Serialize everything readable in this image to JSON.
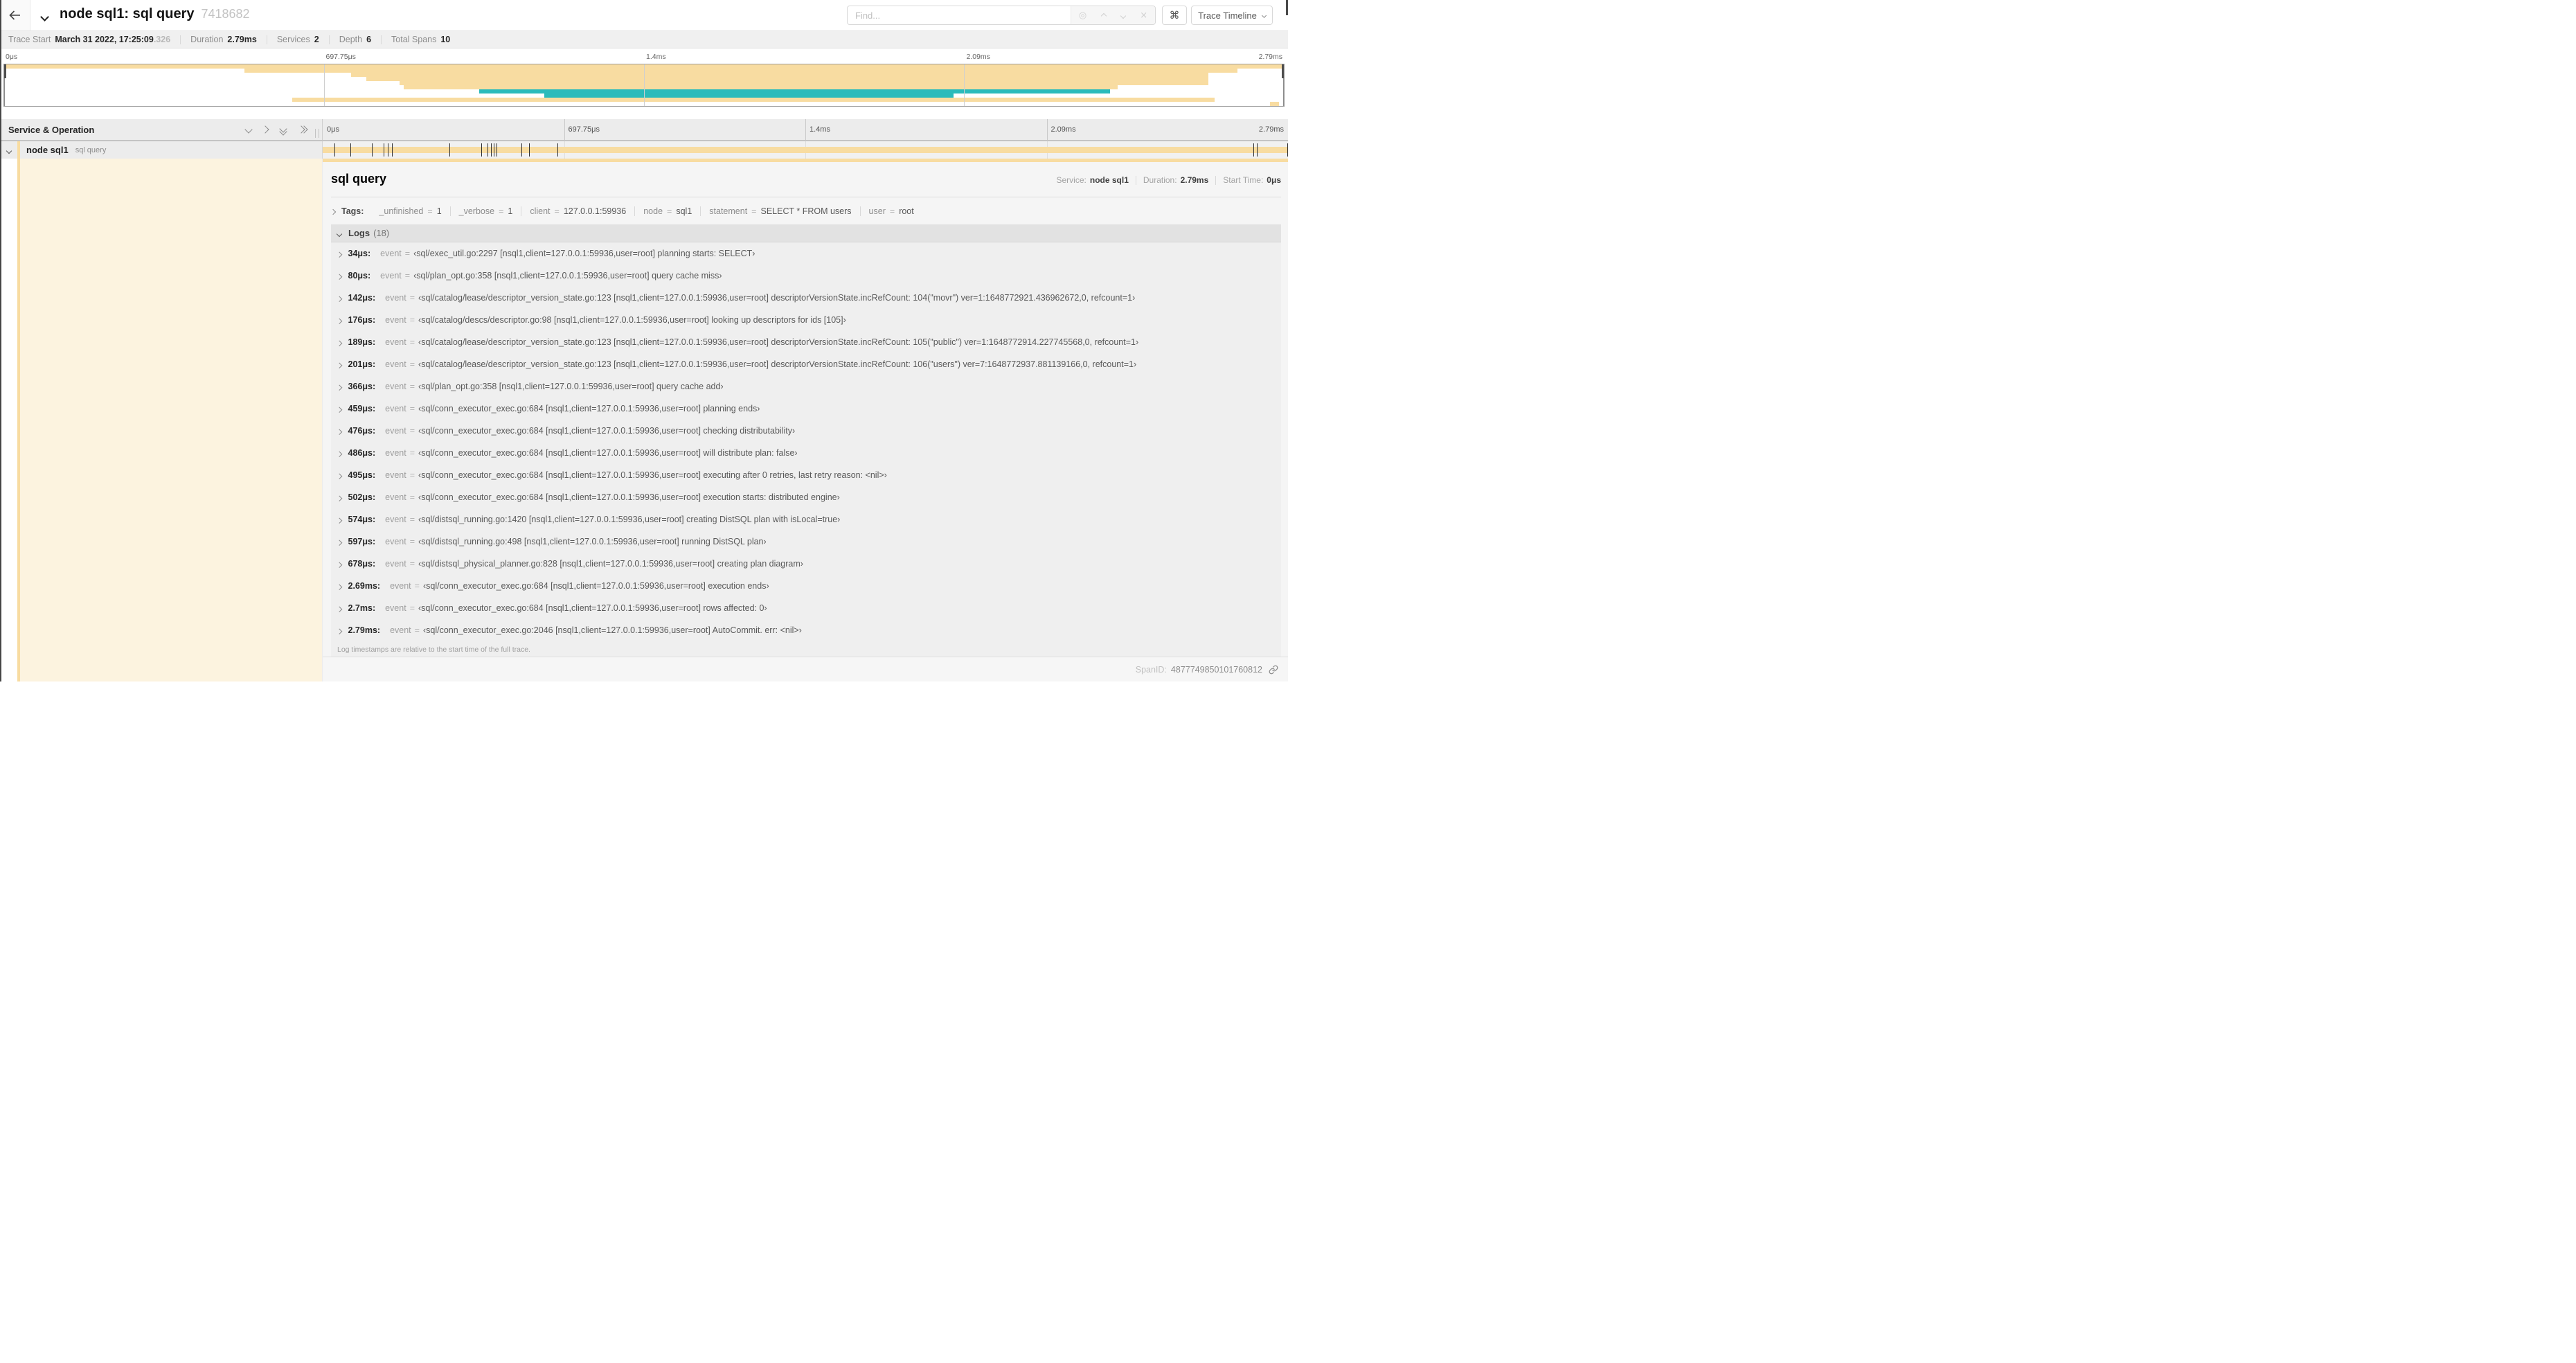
{
  "header": {
    "title": "node sql1: sql query",
    "trace_id": "7418682",
    "find_placeholder": "Find...",
    "shortcut_key": "⌘",
    "view_selector": "Trace Timeline"
  },
  "stats": [
    {
      "label": "Trace Start",
      "value": "March 31 2022, 17:25:09",
      "suffix": ".326"
    },
    {
      "label": "Duration",
      "value": "2.79ms"
    },
    {
      "label": "Services",
      "value": "2"
    },
    {
      "label": "Depth",
      "value": "6"
    },
    {
      "label": "Total Spans",
      "value": "10"
    }
  ],
  "timeline": {
    "total_us": 2790,
    "ruler_ticks": [
      {
        "label": "0μs",
        "pos": 0
      },
      {
        "label": "697.75μs",
        "pos": 25
      },
      {
        "label": "1.4ms",
        "pos": 50
      },
      {
        "label": "2.09ms",
        "pos": 75
      },
      {
        "label": "2.79ms",
        "pos": 100,
        "align": "right"
      }
    ],
    "colors": {
      "tan": "#F8DCA1",
      "teal": "#2BBBBB"
    },
    "minimap_rows": [
      {
        "start": 0,
        "end": 100,
        "color": "tan"
      },
      {
        "start": 18.8,
        "end": 96.4,
        "color": "tan"
      },
      {
        "start": 27.1,
        "end": 94.1,
        "color": "tan"
      },
      {
        "start": 28.3,
        "end": 94.1,
        "color": "tan"
      },
      {
        "start": 30.9,
        "end": 94.1,
        "color": "tan"
      },
      {
        "start": 31.2,
        "end": 87.0,
        "color": "tan"
      },
      {
        "start": 37.1,
        "end": 86.4,
        "color": "teal"
      },
      {
        "start": 42.2,
        "end": 74.2,
        "color": "teal"
      },
      {
        "start": 22.5,
        "end": 94.6,
        "color": "tan"
      },
      {
        "start": 98.9,
        "end": 99.6,
        "color": "tan"
      }
    ]
  },
  "span_table": {
    "header_label": "Service & Operation",
    "row": {
      "service": "node sql1",
      "operation": "sql query"
    }
  },
  "detail": {
    "title": "sql query",
    "meta": [
      {
        "label": "Service:",
        "value": "node sql1"
      },
      {
        "label": "Duration:",
        "value": "2.79ms"
      },
      {
        "label": "Start Time:",
        "value": "0μs"
      }
    ],
    "tags_label": "Tags:",
    "tags": [
      {
        "key": "_unfinished",
        "value": "1"
      },
      {
        "key": "_verbose",
        "value": "1"
      },
      {
        "key": "client",
        "value": "127.0.0.1:59936"
      },
      {
        "key": "node",
        "value": "sql1"
      },
      {
        "key": "statement",
        "value": "SELECT * FROM users"
      },
      {
        "key": "user",
        "value": "root"
      }
    ],
    "logs_label": "Logs",
    "logs_count": "(18)",
    "logs": [
      {
        "ts": "34μs",
        "t_us": 34,
        "key": "event",
        "value": "‹sql/exec_util.go:2297 [nsql1,client=127.0.0.1:59936,user=root] planning starts: SELECT›"
      },
      {
        "ts": "80μs",
        "t_us": 80,
        "key": "event",
        "value": "‹sql/plan_opt.go:358 [nsql1,client=127.0.0.1:59936,user=root] query cache miss›"
      },
      {
        "ts": "142μs",
        "t_us": 142,
        "key": "event",
        "value": "‹sql/catalog/lease/descriptor_version_state.go:123 [nsql1,client=127.0.0.1:59936,user=root] descriptorVersionState.incRefCount: 104(\"movr\") ver=1:1648772921.436962672,0, refcount=1›"
      },
      {
        "ts": "176μs",
        "t_us": 176,
        "key": "event",
        "value": "‹sql/catalog/descs/descriptor.go:98 [nsql1,client=127.0.0.1:59936,user=root] looking up descriptors for ids [105]›"
      },
      {
        "ts": "189μs",
        "t_us": 189,
        "key": "event",
        "value": "‹sql/catalog/lease/descriptor_version_state.go:123 [nsql1,client=127.0.0.1:59936,user=root] descriptorVersionState.incRefCount: 105(\"public\") ver=1:1648772914.227745568,0, refcount=1›"
      },
      {
        "ts": "201μs",
        "t_us": 201,
        "key": "event",
        "value": "‹sql/catalog/lease/descriptor_version_state.go:123 [nsql1,client=127.0.0.1:59936,user=root] descriptorVersionState.incRefCount: 106(\"users\") ver=7:1648772937.881139166,0, refcount=1›"
      },
      {
        "ts": "366μs",
        "t_us": 366,
        "key": "event",
        "value": "‹sql/plan_opt.go:358 [nsql1,client=127.0.0.1:59936,user=root] query cache add›"
      },
      {
        "ts": "459μs",
        "t_us": 459,
        "key": "event",
        "value": "‹sql/conn_executor_exec.go:684 [nsql1,client=127.0.0.1:59936,user=root] planning ends›"
      },
      {
        "ts": "476μs",
        "t_us": 476,
        "key": "event",
        "value": "‹sql/conn_executor_exec.go:684 [nsql1,client=127.0.0.1:59936,user=root] checking distributability›"
      },
      {
        "ts": "486μs",
        "t_us": 486,
        "key": "event",
        "value": "‹sql/conn_executor_exec.go:684 [nsql1,client=127.0.0.1:59936,user=root] will distribute plan: false›"
      },
      {
        "ts": "495μs",
        "t_us": 495,
        "key": "event",
        "value": "‹sql/conn_executor_exec.go:684 [nsql1,client=127.0.0.1:59936,user=root] executing after 0 retries, last retry reason: <nil>›"
      },
      {
        "ts": "502μs",
        "t_us": 502,
        "key": "event",
        "value": "‹sql/conn_executor_exec.go:684 [nsql1,client=127.0.0.1:59936,user=root] execution starts: distributed engine›"
      },
      {
        "ts": "574μs",
        "t_us": 574,
        "key": "event",
        "value": "‹sql/distsql_running.go:1420 [nsql1,client=127.0.0.1:59936,user=root] creating DistSQL plan with isLocal=true›"
      },
      {
        "ts": "597μs",
        "t_us": 597,
        "key": "event",
        "value": "‹sql/distsql_running.go:498 [nsql1,client=127.0.0.1:59936,user=root] running DistSQL plan›"
      },
      {
        "ts": "678μs",
        "t_us": 678,
        "key": "event",
        "value": "‹sql/distsql_physical_planner.go:828 [nsql1,client=127.0.0.1:59936,user=root] creating plan diagram›"
      },
      {
        "ts": "2.69ms",
        "t_us": 2690,
        "key": "event",
        "value": "‹sql/conn_executor_exec.go:684 [nsql1,client=127.0.0.1:59936,user=root] execution ends›"
      },
      {
        "ts": "2.7ms",
        "t_us": 2700,
        "key": "event",
        "value": "‹sql/conn_executor_exec.go:684 [nsql1,client=127.0.0.1:59936,user=root] rows affected: 0›"
      },
      {
        "ts": "2.79ms",
        "t_us": 2790,
        "key": "event",
        "value": "‹sql/conn_executor_exec.go:2046 [nsql1,client=127.0.0.1:59936,user=root] AutoCommit. err: <nil>›"
      }
    ],
    "logs_note": "Log timestamps are relative to the start time of the full trace.",
    "span_id_label": "SpanID:",
    "span_id": "4877749850101760812"
  }
}
